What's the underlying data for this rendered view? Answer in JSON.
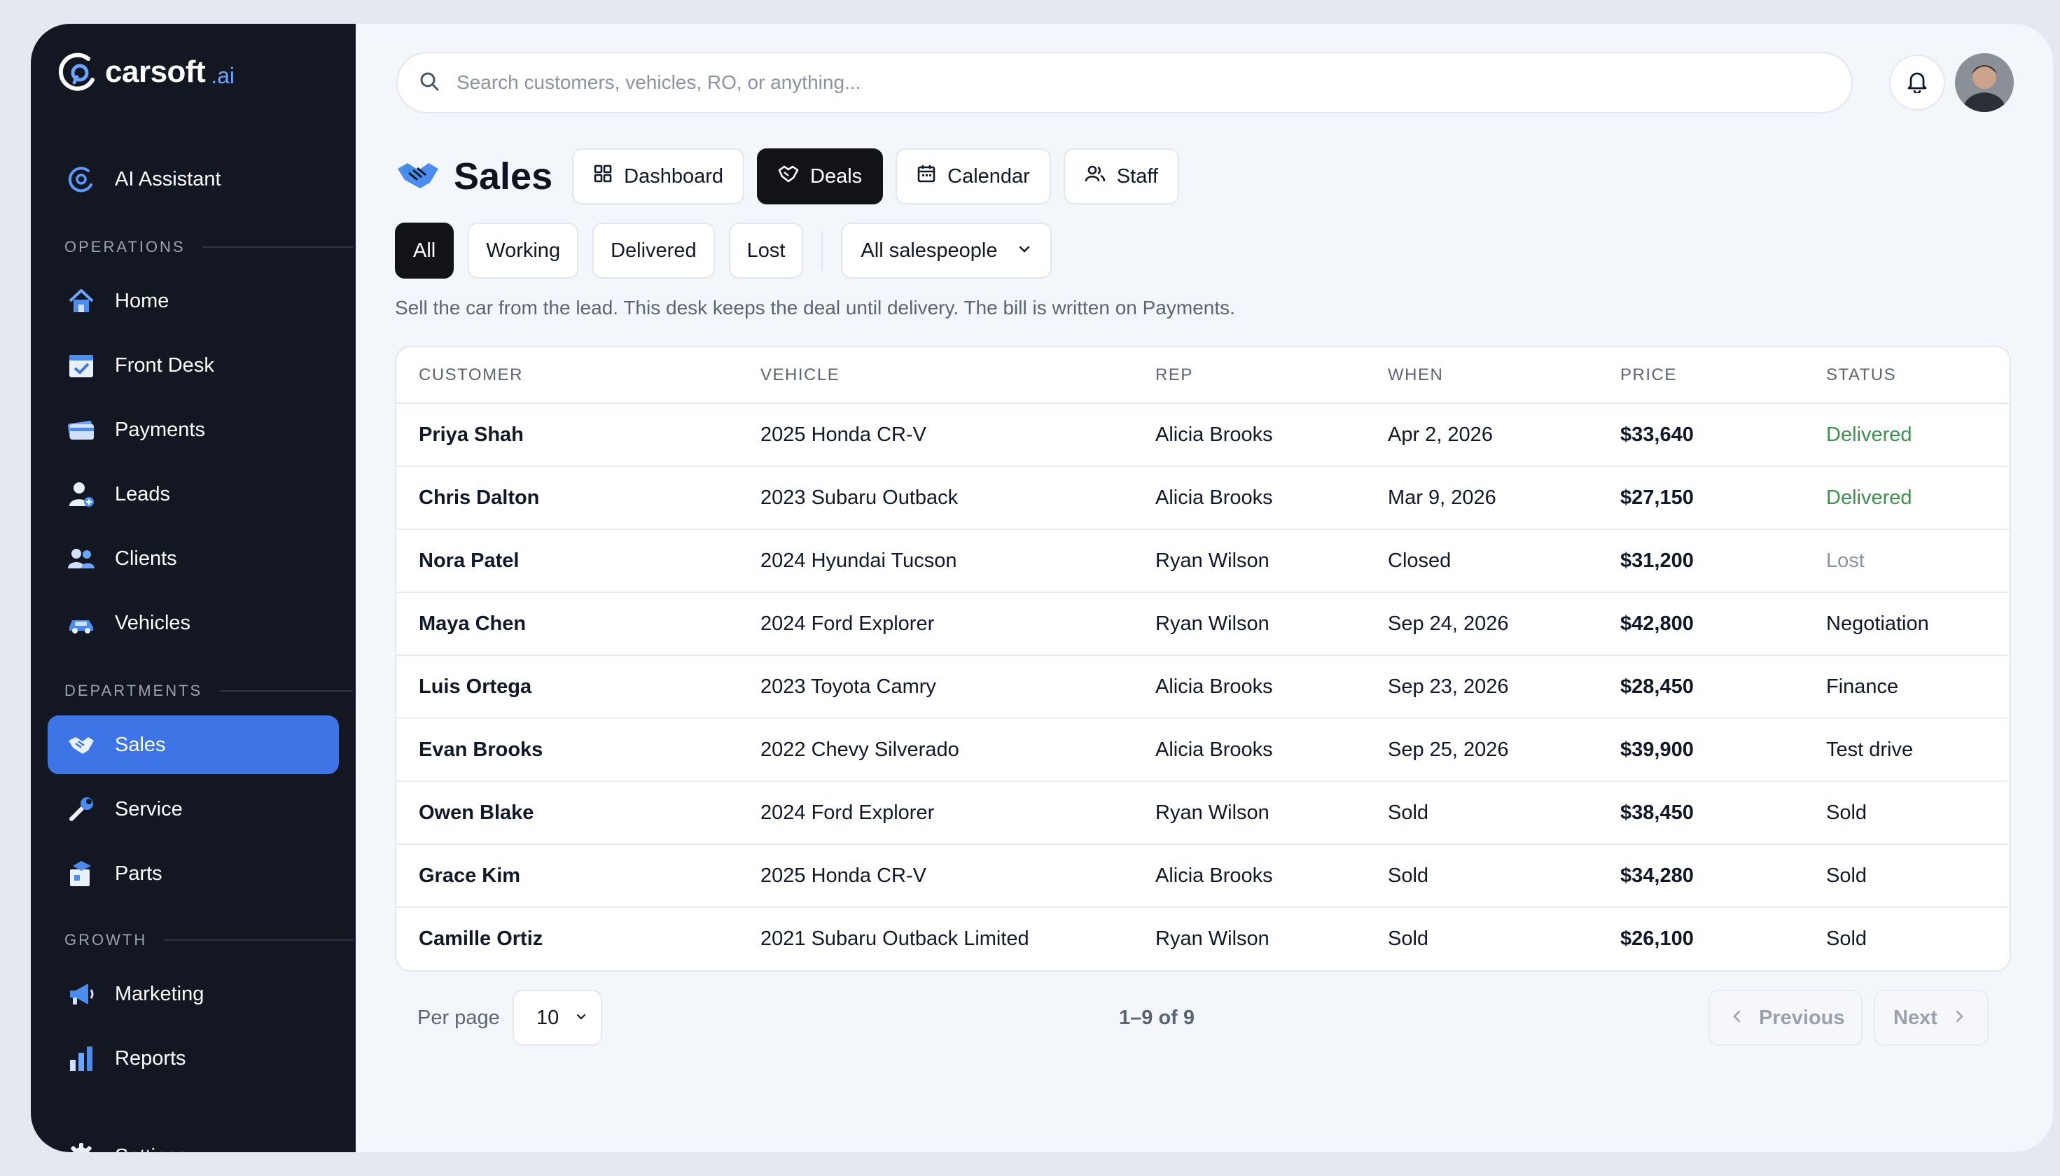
{
  "app": {
    "logo_name": "carsoft",
    "logo_suffix": ".ai",
    "accent_color": "#3d74e6"
  },
  "sidebar": {
    "assistant": {
      "label": "AI Assistant",
      "icon": "ai-assistant-icon"
    },
    "sections": [
      {
        "label": "OPERATIONS",
        "items": [
          {
            "label": "Home",
            "icon": "home-icon"
          },
          {
            "label": "Front Desk",
            "icon": "calendar-check-icon"
          },
          {
            "label": "Payments",
            "icon": "credit-card-icon"
          },
          {
            "label": "Leads",
            "icon": "user-plus-icon"
          },
          {
            "label": "Clients",
            "icon": "users-icon"
          },
          {
            "label": "Vehicles",
            "icon": "car-icon"
          }
        ]
      },
      {
        "label": "DEPARTMENTS",
        "items": [
          {
            "label": "Sales",
            "icon": "handshake-icon",
            "active": true
          },
          {
            "label": "Service",
            "icon": "wrench-icon"
          },
          {
            "label": "Parts",
            "icon": "parts-box-icon"
          }
        ]
      },
      {
        "label": "GROWTH",
        "items": [
          {
            "label": "Marketing",
            "icon": "megaphone-icon"
          },
          {
            "label": "Reports",
            "icon": "bar-chart-icon"
          }
        ]
      }
    ],
    "settings": {
      "label": "Settings",
      "icon": "gear-icon"
    }
  },
  "search": {
    "placeholder": "Search customers, vehicles, RO, or anything..."
  },
  "page": {
    "title": "Sales",
    "tabs": [
      {
        "label": "Dashboard",
        "icon": "grid-icon"
      },
      {
        "label": "Deals",
        "icon": "handshake-outline-icon",
        "active": true
      },
      {
        "label": "Calendar",
        "icon": "calendar-icon"
      },
      {
        "label": "Staff",
        "icon": "people-icon"
      }
    ],
    "filters": [
      "All",
      "Working",
      "Delivered",
      "Lost"
    ],
    "active_filter": "All",
    "salesperson_select": "All salespeople",
    "description": "Sell the car from the lead. This desk keeps the deal until delivery. The bill is written on Payments."
  },
  "table": {
    "headers": [
      "CUSTOMER",
      "VEHICLE",
      "REP",
      "WHEN",
      "PRICE",
      "STATUS"
    ],
    "rows": [
      {
        "customer": "Priya Shah",
        "vehicle": "2025 Honda CR-V",
        "rep": "Alicia Brooks",
        "when": "Apr 2, 2026",
        "price": "$33,640",
        "status": "Delivered"
      },
      {
        "customer": "Chris Dalton",
        "vehicle": "2023 Subaru Outback",
        "rep": "Alicia Brooks",
        "when": "Mar 9, 2026",
        "price": "$27,150",
        "status": "Delivered"
      },
      {
        "customer": "Nora Patel",
        "vehicle": "2024 Hyundai Tucson",
        "rep": "Ryan Wilson",
        "when": "Closed",
        "price": "$31,200",
        "status": "Lost"
      },
      {
        "customer": "Maya Chen",
        "vehicle": "2024 Ford Explorer",
        "rep": "Ryan Wilson",
        "when": "Sep 24, 2026",
        "price": "$42,800",
        "status": "Negotiation"
      },
      {
        "customer": "Luis Ortega",
        "vehicle": "2023 Toyota Camry",
        "rep": "Alicia Brooks",
        "when": "Sep 23, 2026",
        "price": "$28,450",
        "status": "Finance"
      },
      {
        "customer": "Evan Brooks",
        "vehicle": "2022 Chevy Silverado",
        "rep": "Alicia Brooks",
        "when": "Sep 25, 2026",
        "price": "$39,900",
        "status": "Test drive"
      },
      {
        "customer": "Owen Blake",
        "vehicle": "2024 Ford Explorer",
        "rep": "Ryan Wilson",
        "when": "Sold",
        "price": "$38,450",
        "status": "Sold"
      },
      {
        "customer": "Grace Kim",
        "vehicle": "2025 Honda CR-V",
        "rep": "Alicia Brooks",
        "when": "Sold",
        "price": "$34,280",
        "status": "Sold"
      },
      {
        "customer": "Camille Ortiz",
        "vehicle": "2021 Subaru Outback Limited",
        "rep": "Ryan Wilson",
        "when": "Sold",
        "price": "$26,100",
        "status": "Sold"
      }
    ]
  },
  "pagination": {
    "per_page_label": "Per page",
    "per_page_value": "10",
    "range": "1–9 of 9",
    "previous": "Previous",
    "next": "Next"
  }
}
